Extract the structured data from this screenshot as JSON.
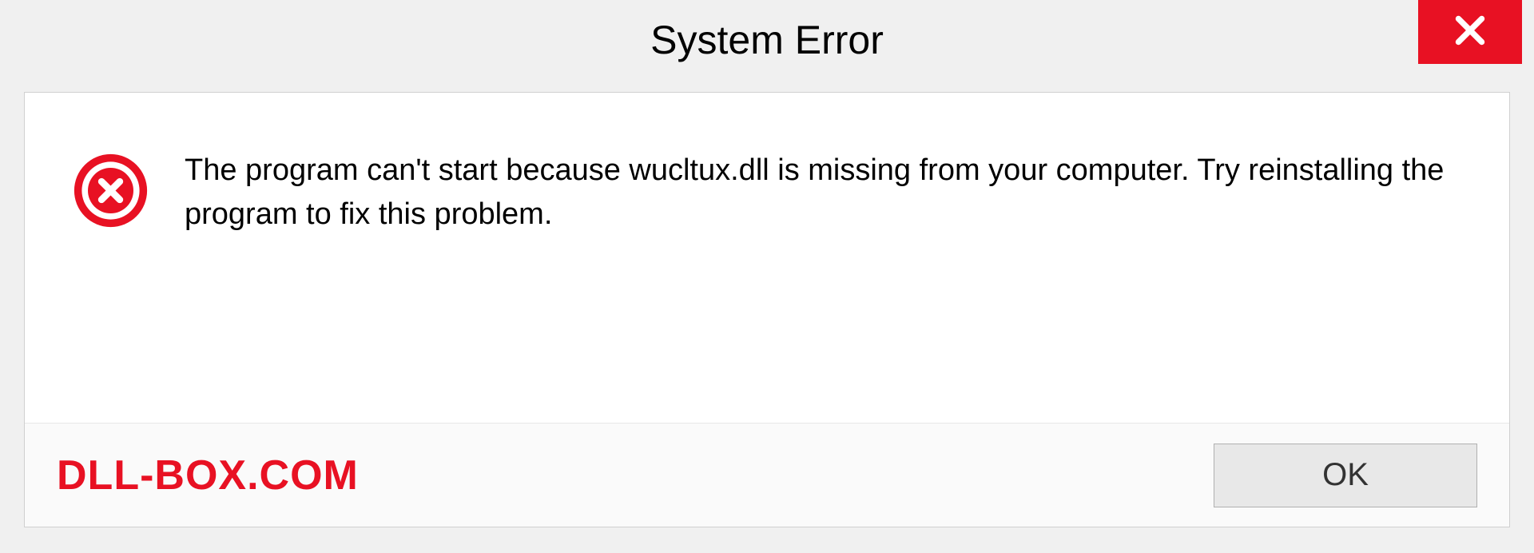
{
  "title": "System Error",
  "message": "The program can't start because wucltux.dll is missing from your computer. Try reinstalling the program to fix this problem.",
  "watermark": "DLL-BOX.COM",
  "ok_label": "OK"
}
